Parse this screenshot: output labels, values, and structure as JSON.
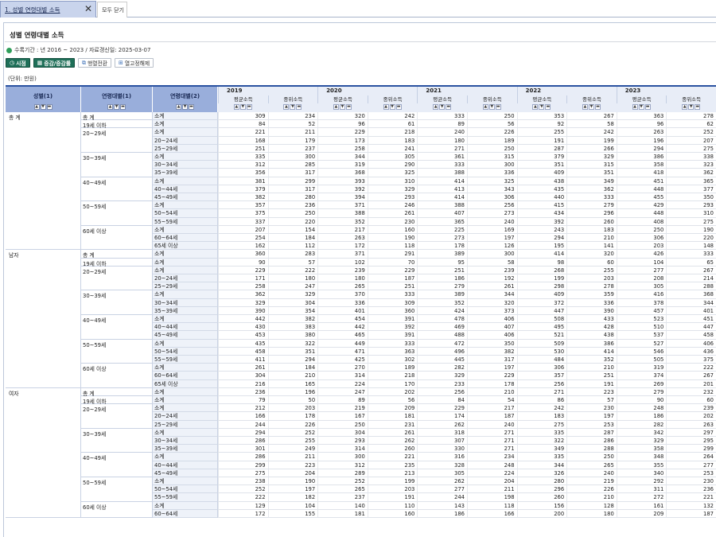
{
  "tabs": {
    "active_label": "1. 성별 연령대별 소득",
    "close_all": "모두 닫기"
  },
  "page_title": "성별 연령대별 소득",
  "period_text": "수록기간 : 년 2016 ~ 2023 / 자료갱신일: 2025-03-07",
  "toolbar": {
    "time": "시점",
    "change": "증감/증감률",
    "pivot": "행렬전환",
    "clear": "열고정해제"
  },
  "unit_text": "(단위: 만원)",
  "headers": {
    "gender": "성별(1)",
    "age1": "연령대별(1)",
    "age2": "연령대별(2)",
    "years": [
      "2019",
      "2020",
      "2021",
      "2022",
      "2023"
    ],
    "measures": [
      "평균소득",
      "중위소득"
    ]
  },
  "colors": {
    "accent": "#2a52a0",
    "green": "#1e6f58",
    "header_blue": "#99aedb"
  },
  "groups": [
    {
      "label": "총 계",
      "subs": [
        {
          "label": "총 계",
          "rows": [
            {
              "age2": "소계",
              "values": [
                309,
                234,
                320,
                242,
                333,
                250,
                353,
                267,
                363,
                278
              ]
            }
          ]
        },
        {
          "label": "19세 이하",
          "rows": [
            {
              "age2": "소계",
              "values": [
                84,
                52,
                96,
                61,
                89,
                56,
                92,
                58,
                96,
                62
              ]
            }
          ]
        },
        {
          "label": "20~29세",
          "rows": [
            {
              "age2": "소계",
              "values": [
                221,
                211,
                229,
                218,
                240,
                226,
                255,
                242,
                263,
                252
              ]
            },
            {
              "age2": "20~24세",
              "values": [
                168,
                179,
                173,
                183,
                180,
                189,
                191,
                199,
                196,
                207
              ]
            },
            {
              "age2": "25~29세",
              "values": [
                251,
                237,
                258,
                241,
                271,
                250,
                287,
                266,
                294,
                275
              ]
            }
          ]
        },
        {
          "label": "30~39세",
          "rows": [
            {
              "age2": "소계",
              "values": [
                335,
                300,
                344,
                305,
                361,
                315,
                379,
                329,
                386,
                338
              ]
            },
            {
              "age2": "30~34세",
              "values": [
                312,
                285,
                319,
                290,
                333,
                300,
                351,
                315,
                358,
                323
              ]
            },
            {
              "age2": "35~39세",
              "values": [
                356,
                317,
                368,
                325,
                388,
                336,
                409,
                351,
                418,
                362
              ]
            }
          ]
        },
        {
          "label": "40~49세",
          "rows": [
            {
              "age2": "소계",
              "values": [
                381,
                299,
                393,
                310,
                414,
                325,
                438,
                349,
                451,
                365
              ]
            },
            {
              "age2": "40~44세",
              "values": [
                379,
                317,
                392,
                329,
                413,
                343,
                435,
                362,
                448,
                377
              ]
            },
            {
              "age2": "45~49세",
              "values": [
                382,
                280,
                394,
                293,
                414,
                306,
                440,
                333,
                455,
                350
              ]
            }
          ]
        },
        {
          "label": "50~59세",
          "rows": [
            {
              "age2": "소계",
              "values": [
                357,
                236,
                371,
                246,
                388,
                256,
                415,
                279,
                429,
                293
              ]
            },
            {
              "age2": "50~54세",
              "values": [
                375,
                250,
                388,
                261,
                407,
                273,
                434,
                296,
                448,
                310
              ]
            },
            {
              "age2": "55~59세",
              "values": [
                337,
                220,
                352,
                230,
                365,
                240,
                392,
                260,
                408,
                275
              ]
            }
          ]
        },
        {
          "label": "60세 이상",
          "rows": [
            {
              "age2": "소계",
              "values": [
                207,
                154,
                217,
                160,
                225,
                169,
                243,
                183,
                250,
                190
              ]
            },
            {
              "age2": "60~64세",
              "values": [
                254,
                184,
                263,
                190,
                273,
                197,
                294,
                210,
                306,
                220
              ]
            },
            {
              "age2": "65세 이상",
              "values": [
                162,
                112,
                172,
                118,
                178,
                126,
                195,
                141,
                203,
                148
              ]
            }
          ]
        }
      ]
    },
    {
      "label": "남자",
      "subs": [
        {
          "label": "총 계",
          "rows": [
            {
              "age2": "소계",
              "values": [
                360,
                283,
                371,
                291,
                389,
                300,
                414,
                320,
                426,
                333
              ]
            }
          ]
        },
        {
          "label": "19세 이하",
          "rows": [
            {
              "age2": "소계",
              "values": [
                90,
                57,
                102,
                70,
                95,
                58,
                98,
                60,
                104,
                65
              ]
            }
          ]
        },
        {
          "label": "20~29세",
          "rows": [
            {
              "age2": "소계",
              "values": [
                229,
                222,
                239,
                229,
                251,
                239,
                268,
                255,
                277,
                267
              ]
            },
            {
              "age2": "20~24세",
              "values": [
                171,
                180,
                180,
                187,
                186,
                192,
                199,
                203,
                208,
                214
              ]
            },
            {
              "age2": "25~29세",
              "values": [
                258,
                247,
                265,
                251,
                279,
                261,
                298,
                278,
                305,
                288
              ]
            }
          ]
        },
        {
          "label": "30~39세",
          "rows": [
            {
              "age2": "소계",
              "values": [
                362,
                329,
                370,
                333,
                389,
                344,
                409,
                359,
                416,
                368
              ]
            },
            {
              "age2": "30~34세",
              "values": [
                329,
                304,
                336,
                309,
                352,
                320,
                372,
                336,
                378,
                344
              ]
            },
            {
              "age2": "35~39세",
              "values": [
                390,
                354,
                401,
                360,
                424,
                373,
                447,
                390,
                457,
                401
              ]
            }
          ]
        },
        {
          "label": "40~49세",
          "rows": [
            {
              "age2": "소계",
              "values": [
                442,
                382,
                454,
                391,
                478,
                406,
                508,
                433,
                523,
                451
              ]
            },
            {
              "age2": "40~44세",
              "values": [
                430,
                383,
                442,
                392,
                469,
                407,
                495,
                428,
                510,
                447
              ]
            },
            {
              "age2": "45~49세",
              "values": [
                453,
                380,
                465,
                391,
                488,
                406,
                521,
                438,
                537,
                458
              ]
            }
          ]
        },
        {
          "label": "50~59세",
          "rows": [
            {
              "age2": "소계",
              "values": [
                435,
                322,
                449,
                333,
                472,
                350,
                509,
                386,
                527,
                406
              ]
            },
            {
              "age2": "50~54세",
              "values": [
                458,
                351,
                471,
                363,
                496,
                382,
                530,
                414,
                546,
                436
              ]
            },
            {
              "age2": "55~59세",
              "values": [
                411,
                294,
                425,
                302,
                445,
                317,
                484,
                352,
                505,
                375
              ]
            }
          ]
        },
        {
          "label": "60세 이상",
          "rows": [
            {
              "age2": "소계",
              "values": [
                261,
                184,
                270,
                189,
                282,
                197,
                306,
                210,
                319,
                222
              ]
            },
            {
              "age2": "60~64세",
              "values": [
                304,
                210,
                314,
                218,
                329,
                229,
                357,
                251,
                374,
                267
              ]
            },
            {
              "age2": "65세 이상",
              "values": [
                216,
                165,
                224,
                170,
                233,
                178,
                256,
                191,
                269,
                201
              ]
            }
          ]
        }
      ]
    },
    {
      "label": "여자",
      "subs": [
        {
          "label": "총 계",
          "rows": [
            {
              "age2": "소계",
              "values": [
                236,
                196,
                247,
                202,
                256,
                210,
                271,
                223,
                279,
                232
              ]
            }
          ]
        },
        {
          "label": "19세 이하",
          "rows": [
            {
              "age2": "소계",
              "values": [
                79,
                50,
                89,
                56,
                84,
                54,
                86,
                57,
                90,
                60
              ]
            }
          ]
        },
        {
          "label": "20~29세",
          "rows": [
            {
              "age2": "소계",
              "values": [
                212,
                203,
                219,
                209,
                229,
                217,
                242,
                230,
                248,
                239
              ]
            },
            {
              "age2": "20~24세",
              "values": [
                166,
                178,
                167,
                181,
                174,
                187,
                183,
                197,
                186,
                202
              ]
            },
            {
              "age2": "25~29세",
              "values": [
                244,
                226,
                250,
                231,
                262,
                240,
                275,
                253,
                282,
                263
              ]
            }
          ]
        },
        {
          "label": "30~39세",
          "rows": [
            {
              "age2": "소계",
              "values": [
                294,
                252,
                304,
                261,
                318,
                271,
                335,
                287,
                342,
                297
              ]
            },
            {
              "age2": "30~34세",
              "values": [
                286,
                255,
                293,
                262,
                307,
                271,
                322,
                286,
                329,
                295
              ]
            },
            {
              "age2": "35~39세",
              "values": [
                301,
                249,
                314,
                260,
                330,
                271,
                349,
                288,
                358,
                299
              ]
            }
          ]
        },
        {
          "label": "40~49세",
          "rows": [
            {
              "age2": "소계",
              "values": [
                286,
                211,
                300,
                221,
                316,
                234,
                335,
                250,
                348,
                264
              ]
            },
            {
              "age2": "40~44세",
              "values": [
                299,
                223,
                312,
                235,
                328,
                248,
                344,
                265,
                355,
                277
              ]
            },
            {
              "age2": "45~49세",
              "values": [
                275,
                204,
                289,
                213,
                305,
                224,
                326,
                240,
                340,
                253
              ]
            }
          ]
        },
        {
          "label": "50~59세",
          "rows": [
            {
              "age2": "소계",
              "values": [
                238,
                190,
                252,
                199,
                262,
                204,
                280,
                219,
                292,
                230
              ]
            },
            {
              "age2": "50~54세",
              "values": [
                252,
                197,
                265,
                203,
                277,
                211,
                296,
                226,
                311,
                236
              ]
            },
            {
              "age2": "55~59세",
              "values": [
                222,
                182,
                237,
                191,
                244,
                198,
                260,
                210,
                272,
                221
              ]
            }
          ]
        },
        {
          "label": "60세 이상",
          "rows": [
            {
              "age2": "소계",
              "values": [
                129,
                104,
                140,
                110,
                143,
                118,
                156,
                128,
                161,
                132
              ]
            },
            {
              "age2": "60~64세",
              "values": [
                172,
                155,
                181,
                160,
                186,
                166,
                200,
                180,
                209,
                187
              ]
            }
          ]
        }
      ]
    }
  ]
}
